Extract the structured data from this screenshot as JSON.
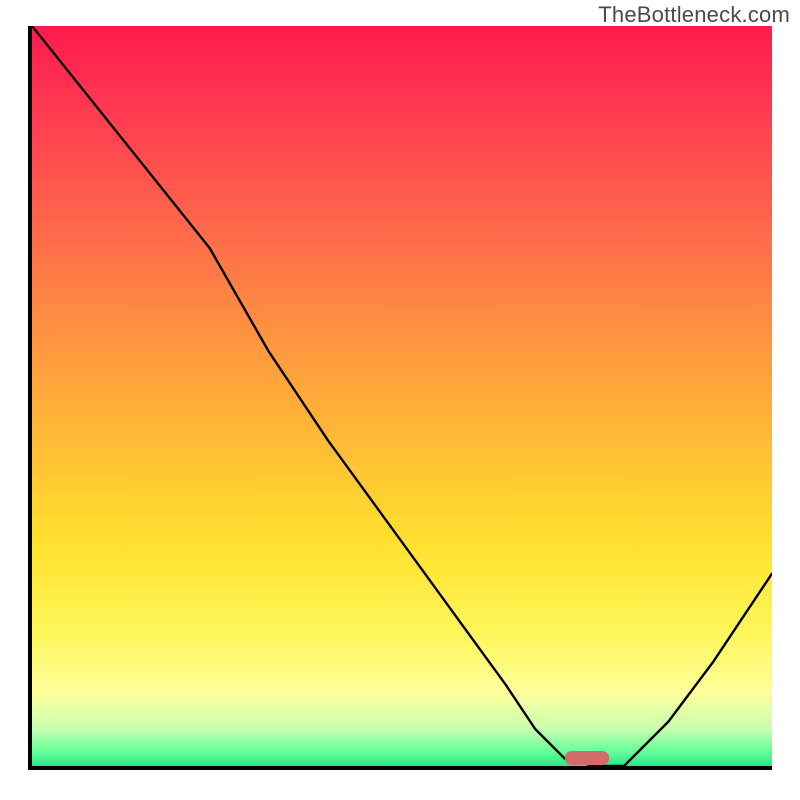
{
  "watermark": "TheBottleneck.com",
  "chart_data": {
    "type": "line",
    "title": "",
    "xlabel": "",
    "ylabel": "",
    "x_range": [
      0,
      100
    ],
    "y_range": [
      0,
      100
    ],
    "series": [
      {
        "name": "bottleneck-curve",
        "x": [
          0,
          8,
          16,
          24,
          32,
          40,
          48,
          56,
          64,
          68,
          72,
          76,
          80,
          86,
          92,
          100
        ],
        "y": [
          100,
          90,
          80,
          70,
          56,
          44,
          33,
          22,
          11,
          5,
          1,
          0,
          0,
          6,
          14,
          26
        ]
      }
    ],
    "marker": {
      "name": "target-marker",
      "x_center": 75,
      "y_center": 0,
      "width": 6,
      "height": 2
    },
    "background": {
      "type": "vertical-gradient",
      "stops": [
        {
          "pos": 0.0,
          "color": "#ff1a4d"
        },
        {
          "pos": 0.42,
          "color": "#ff943f"
        },
        {
          "pos": 0.7,
          "color": "#ffe12e"
        },
        {
          "pos": 0.9,
          "color": "#feff9a"
        },
        {
          "pos": 1.0,
          "color": "#29e78a"
        }
      ]
    }
  }
}
